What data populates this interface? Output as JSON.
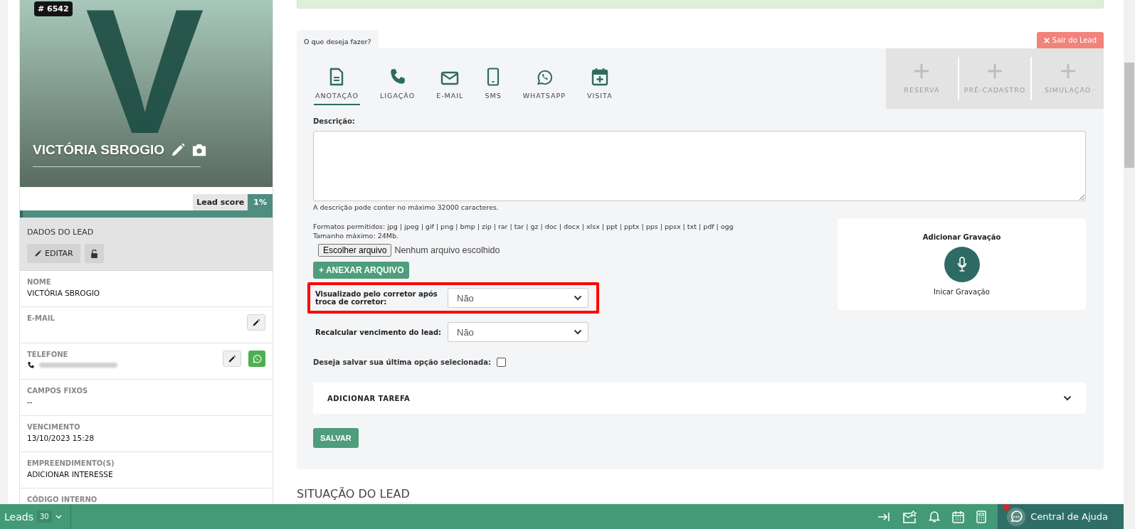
{
  "lead": {
    "id_badge": "# 6542",
    "avatar_initial": "V",
    "name": "VICTÓRIA SBROGIO",
    "score_label": "Lead score",
    "score_value": "1%",
    "score": {
      "level": 0.01
    }
  },
  "lead_data": {
    "title": "DADOS DO LEAD",
    "edit_button": "EDITAR",
    "fields": [
      {
        "kind": "text",
        "label": "NOME",
        "value": "VICTÓRIA SBROGIO"
      },
      {
        "kind": "editable",
        "label": "E-MAIL"
      },
      {
        "kind": "phone",
        "label": "TELEFONE"
      },
      {
        "kind": "text",
        "label": "CAMPOS FIXOS",
        "value": "--"
      },
      {
        "kind": "text",
        "label": "VENCIMENTO",
        "value": "13/10/2023 15:28"
      },
      {
        "kind": "text",
        "label": "EMPREENDIMENTO(S)",
        "value": "ADICIONAR INTERESSE"
      },
      {
        "kind": "text",
        "label": "CÓDIGO INTERNO"
      }
    ]
  },
  "activity": {
    "tab_label": "O que deseja fazer?",
    "exit_button": "Sair do Lead",
    "actions": [
      {
        "kind": "note",
        "label": "ANOTAÇÃO",
        "selected": true
      },
      {
        "kind": "call",
        "label": "LIGAÇÃO",
        "selected": false
      },
      {
        "kind": "email",
        "label": "E-MAIL",
        "selected": false
      },
      {
        "kind": "sms",
        "label": "SMS",
        "selected": false
      },
      {
        "kind": "whatsapp",
        "label": "WHATSAPP",
        "selected": false
      },
      {
        "kind": "visit",
        "label": "VISITA",
        "selected": false
      }
    ],
    "extra_actions": [
      {
        "label": "RESERVA",
        "disabled": true
      },
      {
        "label": "PRÉ-CADASTRO",
        "disabled": true
      },
      {
        "label": "SIMULAÇÃO",
        "disabled": true
      }
    ],
    "description_label": "Descrição:",
    "description_hint": "A descrição pode conter no máximo 32000 caracteres.",
    "formats": "Formatos permitidos: jpg | jpeg | gif | png | bmp | zip | rar | tar | gz | doc | docx | xlsx | ppt | pptx | pps | ppsx | txt | pdf | ogg",
    "max_size": "Tamanho máximo: 24Mb.",
    "file_button": "Escolher arquivo",
    "file_status": "Nenhum arquivo escolhido",
    "attach_button": "+ ANEXAR ARQUIVO",
    "selects": [
      {
        "label": "Visualizado pelo corretor após troca de corretor:",
        "value": "Não",
        "highlighted": true
      },
      {
        "label": "Recalcular vencimento do lead:",
        "value": "Não",
        "highlighted": false
      }
    ],
    "remember": {
      "label": "Deseja salvar sua última opção selecionada:",
      "checked": false
    },
    "task_section": {
      "title": "ADICIONAR TAREFA",
      "expanded": false
    },
    "save_button": "SALVAR",
    "recording": {
      "title": "Adicionar Gravação",
      "caption": "Inicar Gravação"
    }
  },
  "section_title": "SITUAÇÃO DO LEAD",
  "bottom_bar": {
    "leads_label": "Leads",
    "leads_count": "30",
    "help_label": "Central de Ajuda",
    "help_notification": true
  }
}
